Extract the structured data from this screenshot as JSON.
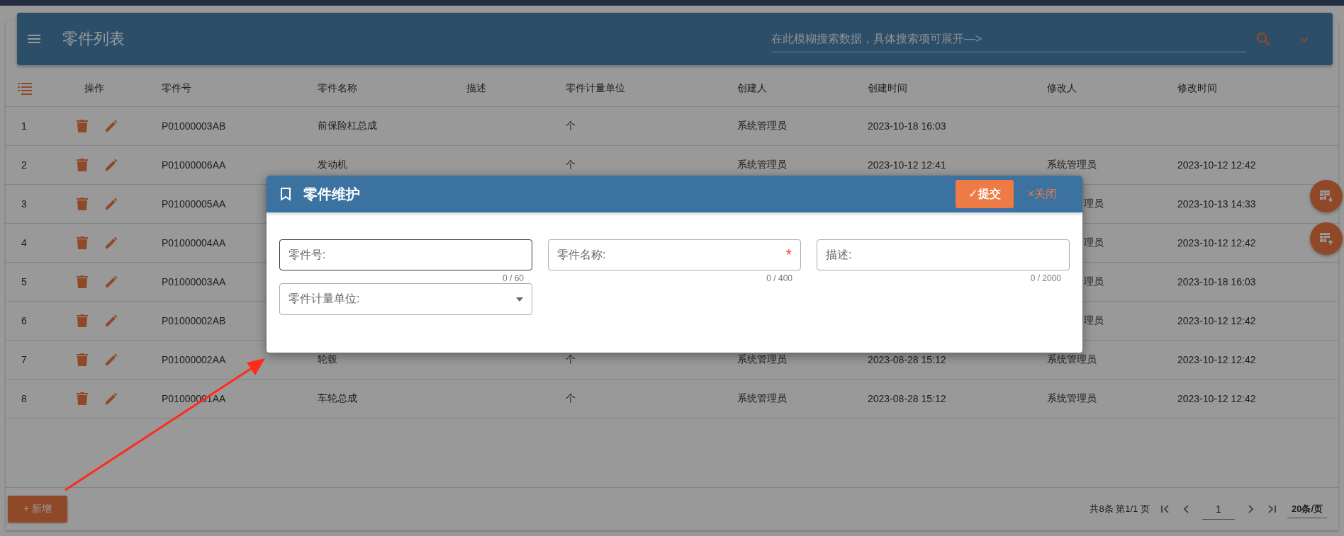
{
  "page": {
    "title": "零件列表",
    "search": {
      "placeholder": "在此模糊搜索数据，具体搜索项可展开—>"
    }
  },
  "table": {
    "actions_header": "操作",
    "columns": [
      "零件号",
      "零件名称",
      "描述",
      "零件计量单位",
      "创建人",
      "创建时间",
      "修改人",
      "修改时间"
    ],
    "rows": [
      {
        "index": "1",
        "cells": [
          {
            "text": "P01000003AB"
          },
          {
            "text": "前保险杠总成"
          },
          null,
          {
            "text": "个"
          },
          {
            "text": "系统管理员"
          },
          {
            "text": "2023-10-18 16:03"
          },
          null,
          null
        ]
      },
      {
        "index": "2",
        "cells": [
          {
            "text": "P01000006AA"
          },
          {
            "text": "发动机"
          },
          null,
          {
            "text": "个"
          },
          {
            "text": "系统管理员"
          },
          {
            "text": "2023-10-12 12:41"
          },
          {
            "text": "系统管理员"
          },
          {
            "text": "2023-10-12 12:42"
          }
        ]
      },
      {
        "index": "3",
        "cells": [
          {
            "text": "P01000005AA"
          },
          null,
          null,
          null,
          null,
          null,
          {
            "text": "理员",
            "covered": true
          },
          {
            "text": "2023-10-13 14:33"
          }
        ]
      },
      {
        "index": "4",
        "cells": [
          {
            "text": "P01000004AA"
          },
          null,
          null,
          null,
          null,
          null,
          {
            "text": "理员",
            "covered": true
          },
          {
            "text": "2023-10-12 12:42"
          }
        ]
      },
      {
        "index": "5",
        "cells": [
          {
            "text": "P01000003AA"
          },
          null,
          null,
          null,
          null,
          null,
          {
            "text": "理员",
            "covered": true
          },
          {
            "text": "2023-10-18 16:03"
          }
        ]
      },
      {
        "index": "6",
        "cells": [
          {
            "text": "P01000002AB"
          },
          null,
          null,
          null,
          null,
          null,
          {
            "text": "理员",
            "covered": true
          },
          {
            "text": "2023-10-12 12:42"
          }
        ]
      },
      {
        "index": "7",
        "cells": [
          {
            "text": "P01000002AA"
          },
          {
            "text": "轮毂"
          },
          null,
          {
            "text": "个"
          },
          {
            "text": "系统管理员"
          },
          {
            "text": "2023-08-28 15:12"
          },
          {
            "text": "系统管理员"
          },
          {
            "text": "2023-10-12 12:42"
          }
        ]
      },
      {
        "index": "8",
        "cells": [
          {
            "text": "P01000001AA"
          },
          {
            "text": "车轮总成"
          },
          null,
          {
            "text": "个"
          },
          {
            "text": "系统管理员"
          },
          {
            "text": "2023-08-28 15:12"
          },
          {
            "text": "系统管理员"
          },
          {
            "text": "2023-10-12 12:42"
          }
        ]
      }
    ]
  },
  "footer": {
    "add_button": "+ 新增",
    "summary": "共8条 第1/1 页",
    "page": "1",
    "page_size": "20条/页"
  },
  "dialog": {
    "title": "零件维护",
    "submit": "✓提交",
    "close": "×关闭",
    "fields": [
      {
        "kind": "text",
        "label": "零件号:",
        "counter": "0 / 60",
        "focused": true
      },
      {
        "kind": "text",
        "label": "零件名称:",
        "counter": "0 / 400",
        "required_marker": "*",
        "focused": false
      },
      {
        "kind": "text",
        "label": "描述:",
        "counter": "0 / 2000",
        "focused": false
      },
      {
        "kind": "select",
        "label": "零件计量单位:",
        "focused": false
      }
    ]
  }
}
